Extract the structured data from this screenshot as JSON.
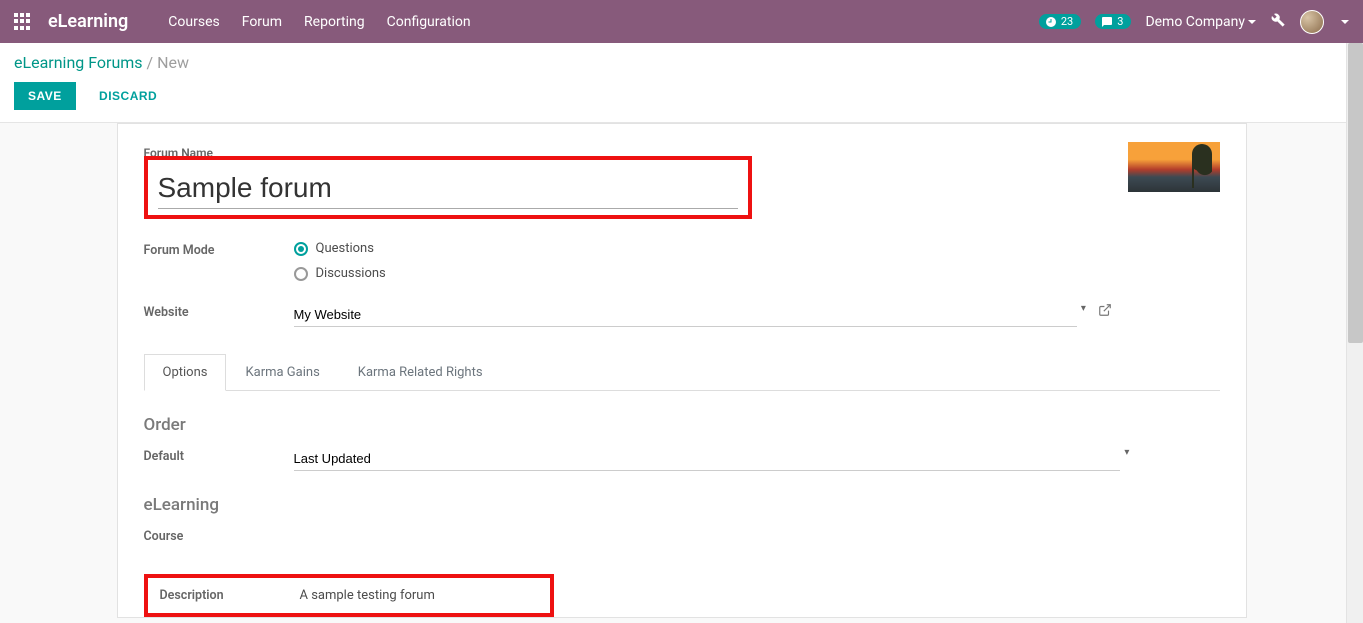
{
  "brand": "eLearning",
  "nav": [
    "Courses",
    "Forum",
    "Reporting",
    "Configuration"
  ],
  "topbar": {
    "activities_count": "23",
    "msgs_count": "3",
    "company": "Demo Company"
  },
  "breadcrumb": {
    "root": "eLearning Forums",
    "leaf": "New"
  },
  "buttons": {
    "save": "SAVE",
    "discard": "DISCARD"
  },
  "form": {
    "name_label": "Forum Name",
    "name_value": "Sample forum",
    "mode_label": "Forum Mode",
    "mode_options": {
      "questions": "Questions",
      "discussions": "Discussions"
    },
    "mode_selected": "questions",
    "website_label": "Website",
    "website_value": "My Website"
  },
  "tabs": [
    "Options",
    "Karma Gains",
    "Karma Related Rights"
  ],
  "options": {
    "order_section": "Order",
    "default_label": "Default",
    "default_value": "Last Updated",
    "elearning_section": "eLearning",
    "course_label": "Course",
    "description_label": "Description",
    "description_value": "A sample testing forum"
  }
}
